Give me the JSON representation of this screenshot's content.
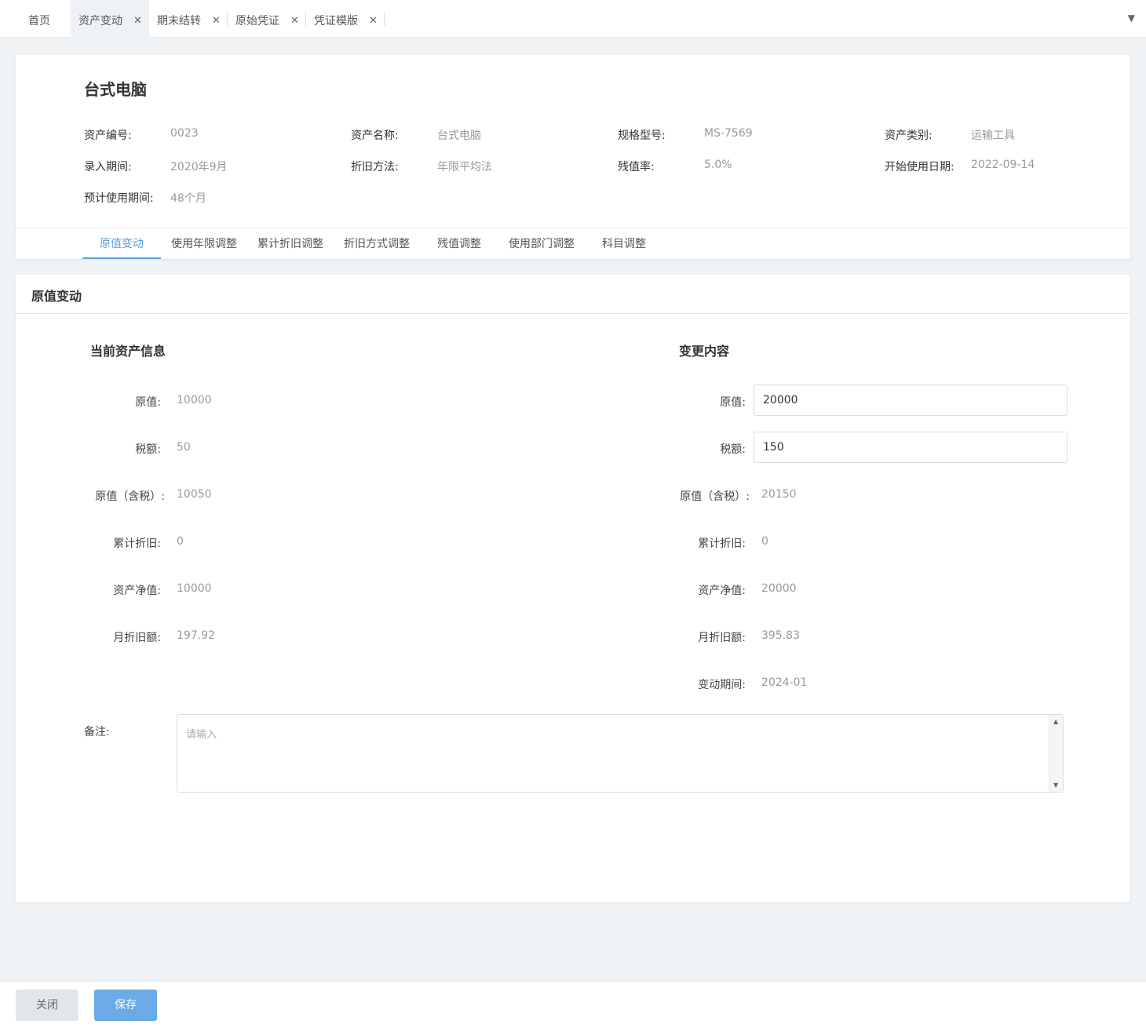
{
  "tabs": [
    {
      "label": "首页",
      "closable": false,
      "active": false
    },
    {
      "label": "资产变动",
      "closable": true,
      "active": true
    },
    {
      "label": "期末结转",
      "closable": true,
      "active": false
    },
    {
      "label": "原始凭证",
      "closable": true,
      "active": false
    },
    {
      "label": "凭证模版",
      "closable": true,
      "active": false
    }
  ],
  "tab_close_glyph": "✕",
  "tab_dropdown_glyph": "▼",
  "asset": {
    "title": "台式电脑",
    "fields": [
      {
        "label": "资产编号:",
        "value": "0023"
      },
      {
        "label": "资产名称:",
        "value": "台式电脑"
      },
      {
        "label": "规格型号:",
        "value": "MS-7569"
      },
      {
        "label": "资产类别:",
        "value": "运输工具"
      },
      {
        "label": "录入期间:",
        "value": "2020年9月"
      },
      {
        "label": "折旧方法:",
        "value": "年限平均法"
      },
      {
        "label": "残值率:",
        "value": "5.0%"
      },
      {
        "label": "开始使用日期:",
        "value": "2022-09-14"
      },
      {
        "label": "预计使用期间:",
        "value": "48个月"
      }
    ]
  },
  "subtabs": [
    "原值变动",
    "使用年限调整",
    "累计折旧调整",
    "折旧方式调整",
    "残值调整",
    "使用部门调整",
    "科目调整"
  ],
  "panel": {
    "title": "原值变动",
    "current": {
      "title": "当前资产信息",
      "rows": [
        {
          "label": "原值:",
          "value": "10000"
        },
        {
          "label": "税额:",
          "value": "50"
        },
        {
          "label": "原值（含税）:",
          "value": "10050"
        },
        {
          "label": "累计折旧:",
          "value": "0"
        },
        {
          "label": "资产净值:",
          "value": "10000"
        },
        {
          "label": "月折旧额:",
          "value": "197.92"
        }
      ]
    },
    "change": {
      "title": "变更内容",
      "rows": [
        {
          "label": "原值:",
          "value": "20000",
          "input": true
        },
        {
          "label": "税额:",
          "value": "150",
          "input": true
        },
        {
          "label": "原值（含税）:",
          "value": "20150"
        },
        {
          "label": "累计折旧:",
          "value": "0"
        },
        {
          "label": "资产净值:",
          "value": "20000"
        },
        {
          "label": "月折旧额:",
          "value": "395.83"
        },
        {
          "label": "变动期间:",
          "value": "2024-01"
        }
      ]
    },
    "remark": {
      "label": "备注:",
      "placeholder": "请输入"
    }
  },
  "footer": {
    "close_label": "关闭",
    "save_label": "保存"
  }
}
